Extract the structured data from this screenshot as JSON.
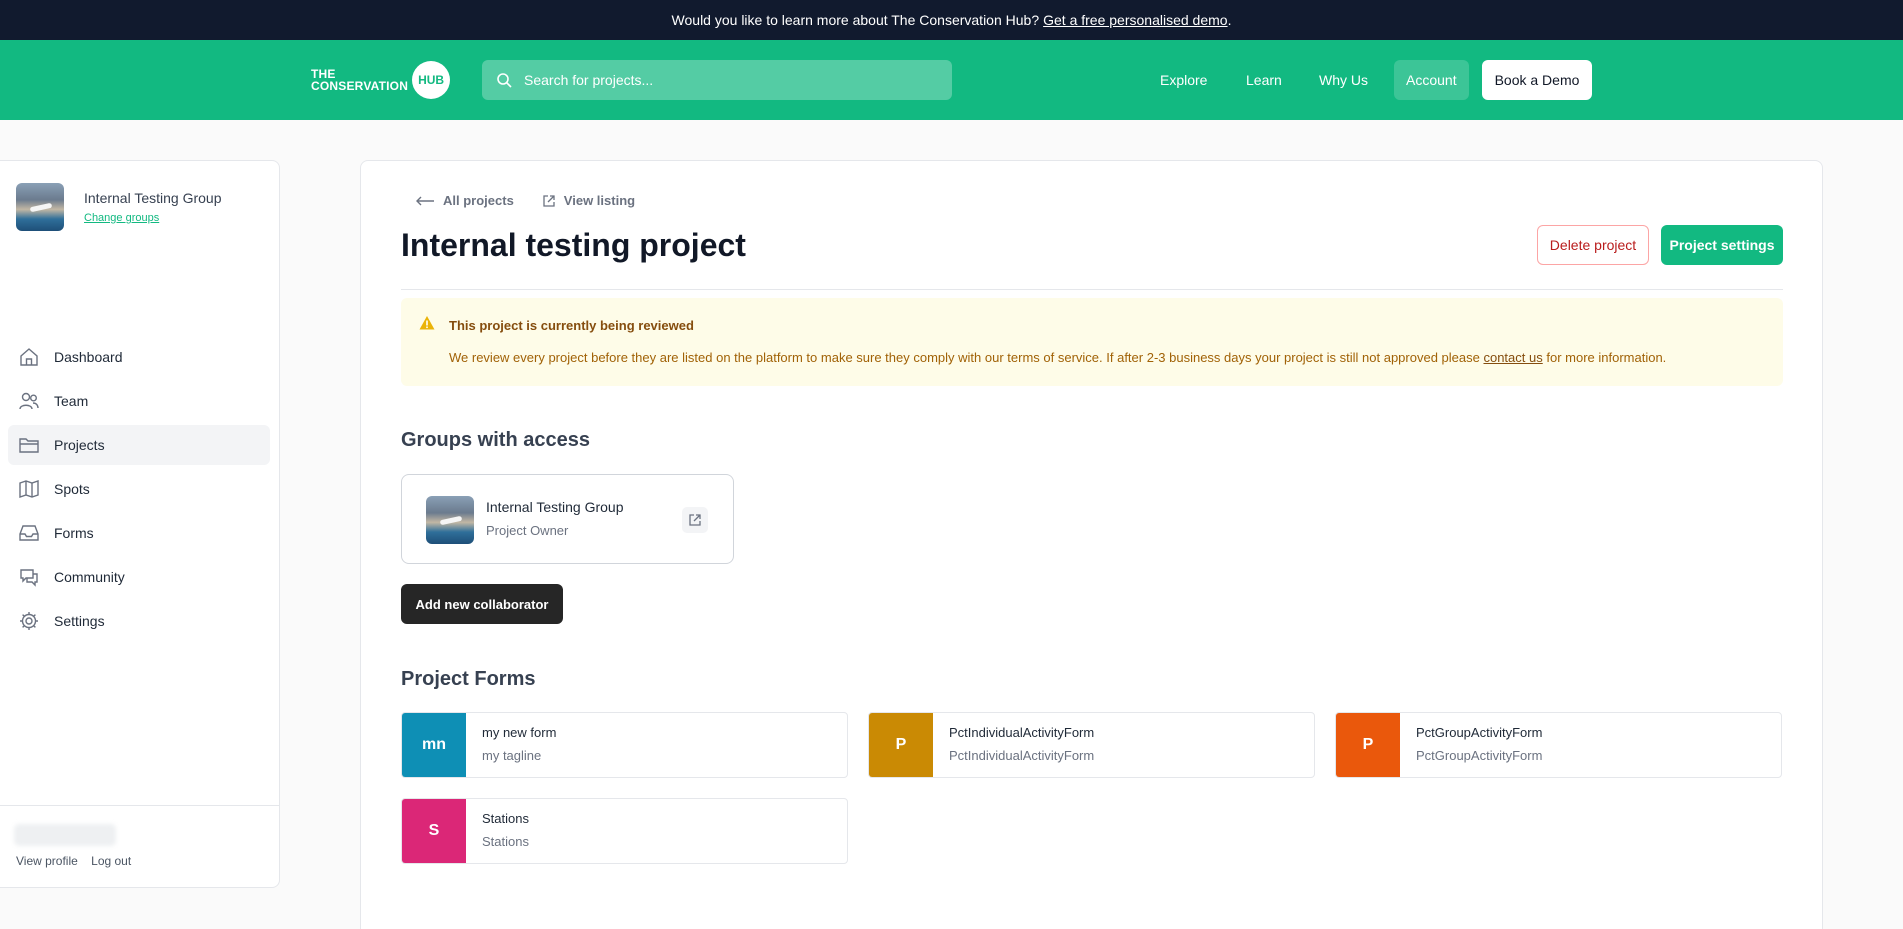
{
  "promo": {
    "text": "Would you like to learn more about The Conservation Hub?",
    "link": "Get a free personalised demo",
    "after": "."
  },
  "header": {
    "logo_line1": "THE",
    "logo_line2": "CONSERVATION",
    "logo_hub": "HUB",
    "search_placeholder": "Search for projects...",
    "nav": [
      "Explore",
      "Learn",
      "Why Us",
      "Account"
    ],
    "demo_button": "Book a Demo"
  },
  "sidebar": {
    "group_name": "Internal Testing Group",
    "change_groups": "Change groups",
    "items": [
      {
        "label": "Dashboard",
        "icon": "home-icon"
      },
      {
        "label": "Team",
        "icon": "users-icon"
      },
      {
        "label": "Projects",
        "icon": "folder-icon",
        "active": true
      },
      {
        "label": "Spots",
        "icon": "map-icon"
      },
      {
        "label": "Forms",
        "icon": "inbox-icon"
      },
      {
        "label": "Community",
        "icon": "chat-icon"
      },
      {
        "label": "Settings",
        "icon": "gear-icon"
      }
    ],
    "view_profile": "View profile",
    "log_out": "Log out"
  },
  "main": {
    "crumb_all": "All projects",
    "crumb_view": "View listing",
    "title": "Internal testing project",
    "delete_button": "Delete project",
    "settings_button": "Project settings",
    "alert": {
      "title": "This project is currently being reviewed",
      "body": "We review every project before they are listed on the platform to make sure they comply with our terms of service. If after 2-3 business days your project is still not approved please",
      "link": "contact us",
      "tail": "for more information."
    },
    "groups_heading": "Groups with access",
    "group_card": {
      "name": "Internal Testing Group",
      "role": "Project Owner"
    },
    "add_collaborator": "Add new collaborator",
    "forms_heading": "Project Forms",
    "forms": [
      {
        "badge": "mn",
        "name": "my new form",
        "sub": "my tagline",
        "color": "#0e8fb5"
      },
      {
        "badge": "P",
        "name": "PctIndividualActivityForm",
        "sub": "PctIndividualActivityForm",
        "color": "#ca8a04"
      },
      {
        "badge": "P",
        "name": "PctGroupActivityForm",
        "sub": "PctGroupActivityForm",
        "color": "#ea580c"
      },
      {
        "badge": "S",
        "name": "Stations",
        "sub": "Stations",
        "color": "#db2777"
      }
    ]
  },
  "colors": {
    "brand": "#12b981",
    "dark": "#111a2e"
  }
}
